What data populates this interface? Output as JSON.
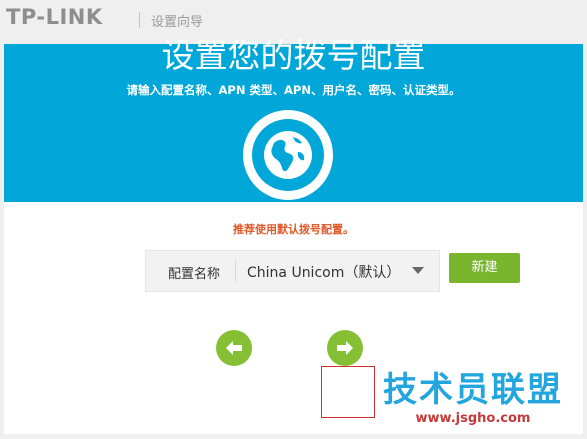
{
  "topbar": {
    "logo": "TP-LINK",
    "wizard_label": "设置向导"
  },
  "banner": {
    "title": "设置您的拨号配置",
    "subtitle": "请输入配置名称、APN 类型、APN、用户名、密码、认证类型。",
    "icon": "globe-icon"
  },
  "main": {
    "recommend_text": "推荐使用默认拨号配置。",
    "profile_label": "配置名称",
    "profile_value": "China Unicom（默认）",
    "new_button": "新建",
    "prev_icon": "arrow-left-icon",
    "next_icon": "arrow-right-icon"
  },
  "watermark": {
    "brand": "技术员联盟",
    "url": "www.jsgho.com"
  },
  "colors": {
    "banner": "#00a7d8",
    "accent_green": "#79b52d",
    "recommend_orange": "#e05a2b",
    "highlight_red": "#d0312a"
  }
}
